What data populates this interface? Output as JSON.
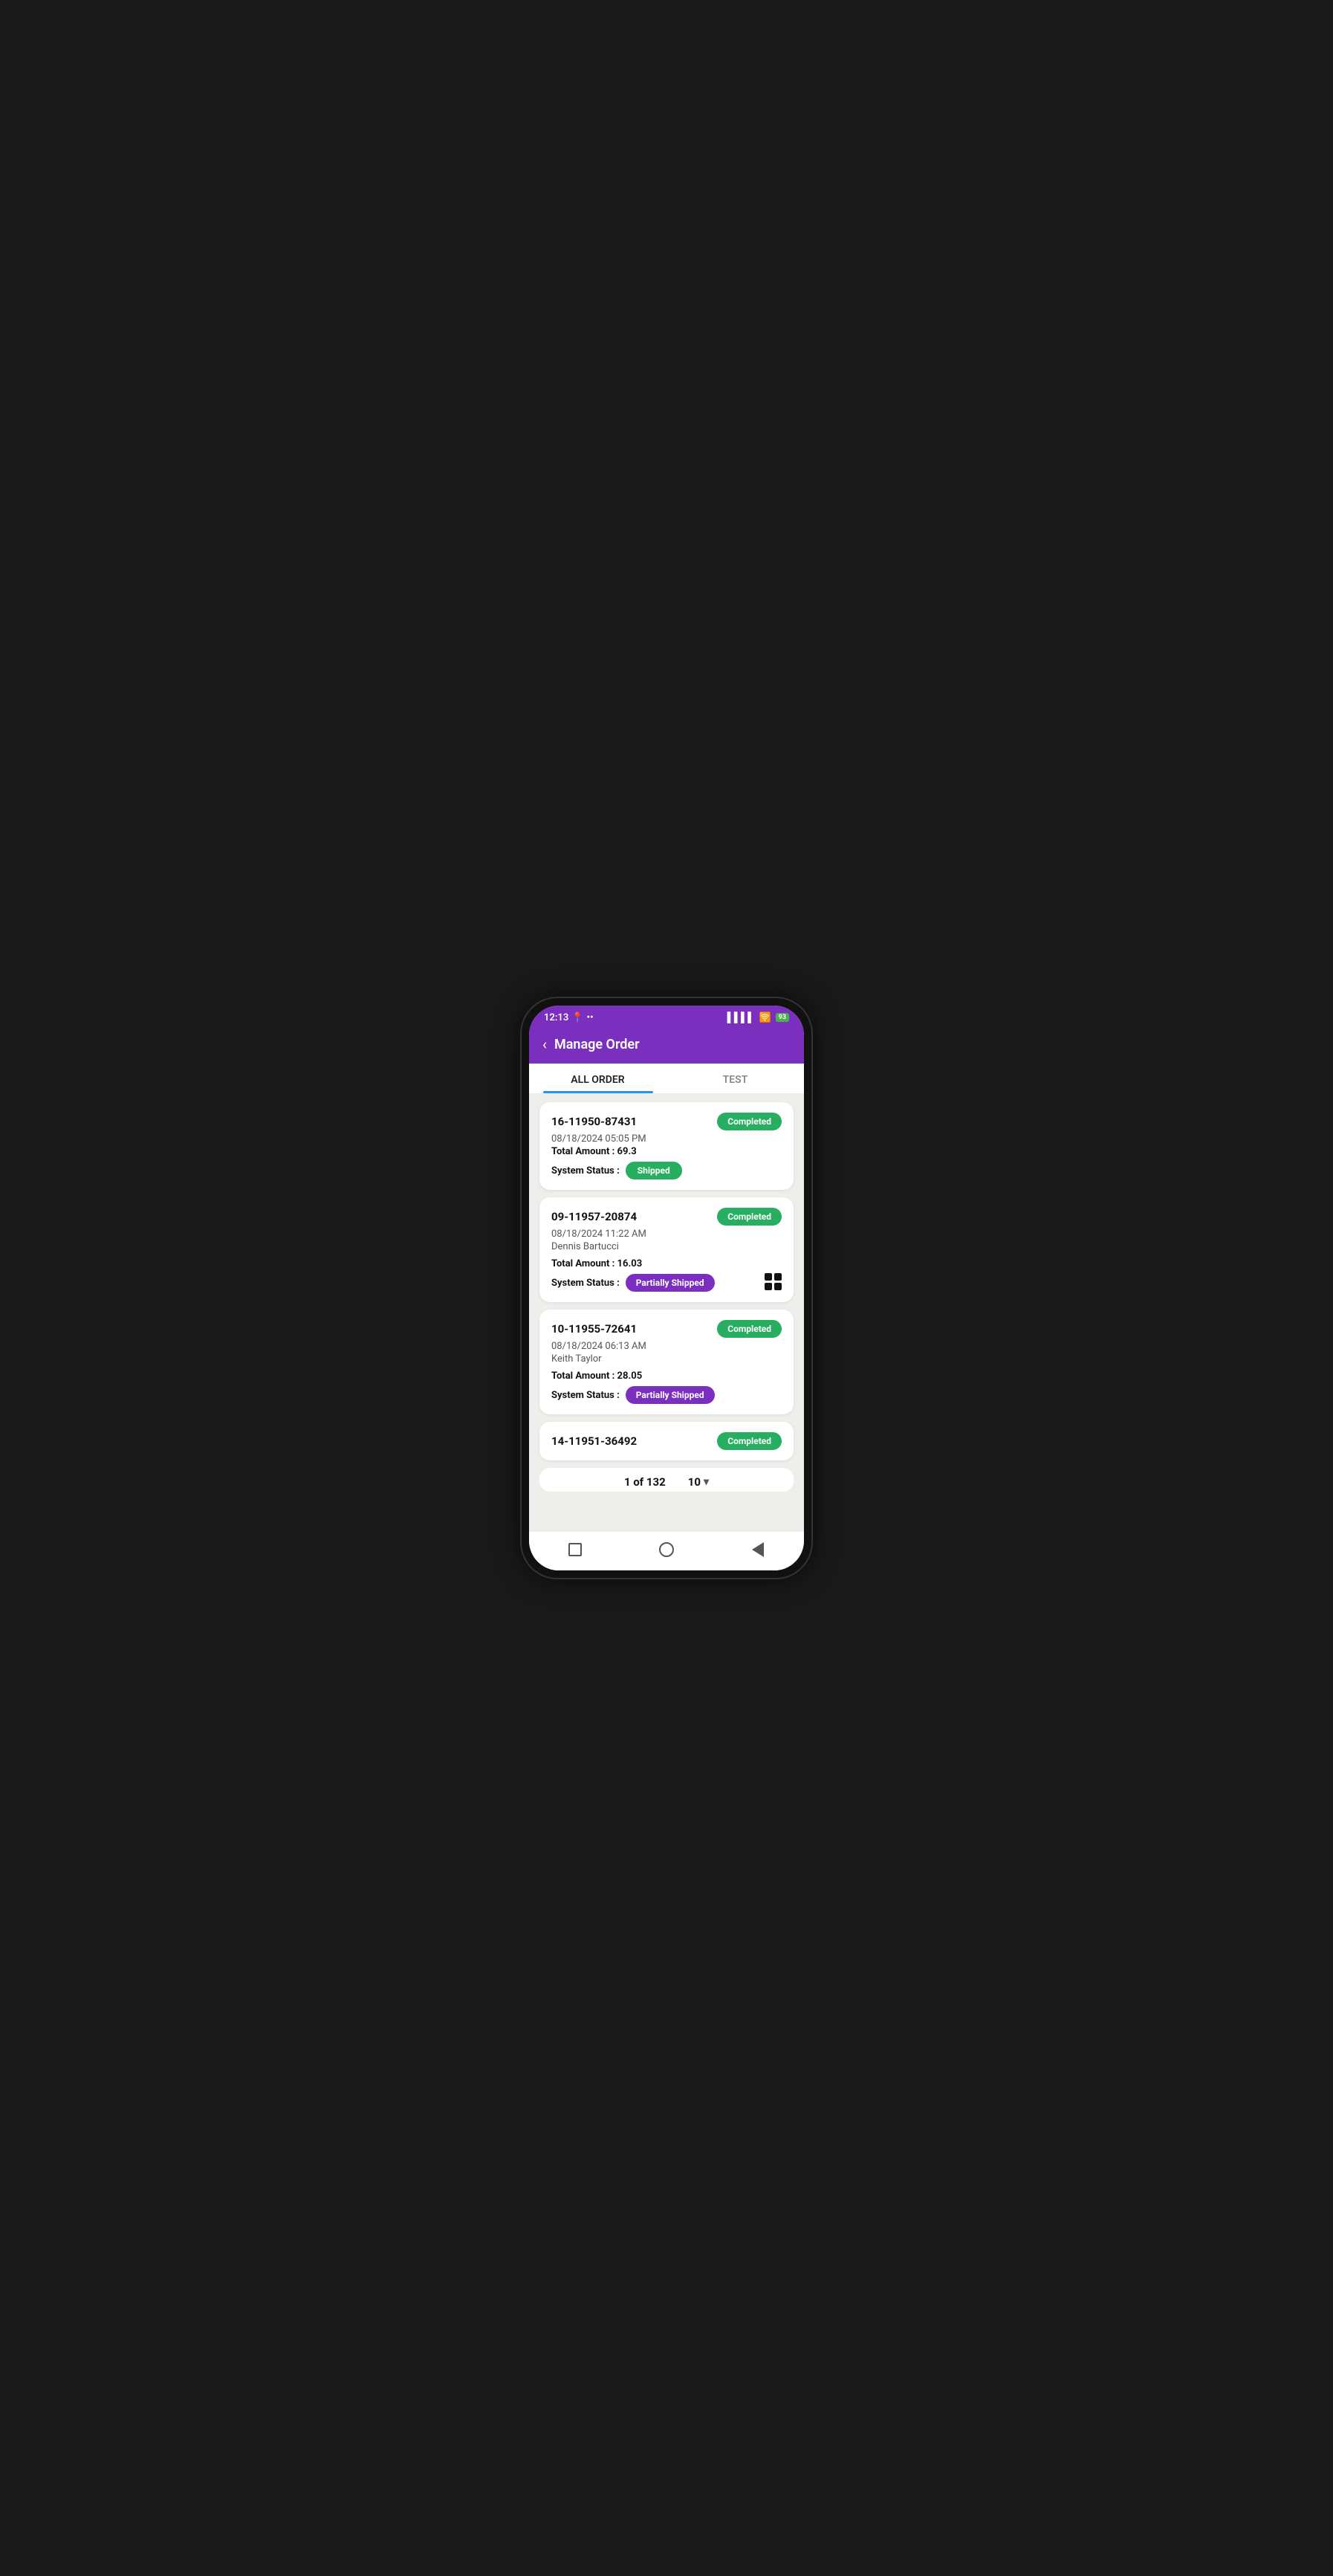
{
  "statusBar": {
    "time": "12:13",
    "battery": "93"
  },
  "header": {
    "title": "Manage Order",
    "backLabel": "‹"
  },
  "tabs": [
    {
      "id": "all-order",
      "label": "ALL ORDER",
      "active": true
    },
    {
      "id": "test",
      "label": "TEST",
      "active": false
    }
  ],
  "orders": [
    {
      "id": "16-11950-87431",
      "date": "08/18/2024 05:05 PM",
      "customer": "",
      "totalAmount": "69.3",
      "status": "Completed",
      "systemStatus": "Shipped",
      "systemStatusType": "shipped"
    },
    {
      "id": "09-11957-20874",
      "date": "08/18/2024 11:22 AM",
      "customer": "Dennis Bartucci",
      "totalAmount": "16.03",
      "status": "Completed",
      "systemStatus": "Partially Shipped",
      "systemStatusType": "partially-shipped"
    },
    {
      "id": "10-11955-72641",
      "date": "08/18/2024 06:13 AM",
      "customer": "Keith Taylor",
      "totalAmount": "28.05",
      "status": "Completed",
      "systemStatus": "Partially Shipped",
      "systemStatusType": "partially-shipped"
    },
    {
      "id": "14-11951-36492",
      "date": "",
      "customer": "",
      "totalAmount": "",
      "status": "Completed",
      "systemStatus": "",
      "systemStatusType": ""
    }
  ],
  "pagination": {
    "current": "1",
    "total": "132",
    "pageSize": "10",
    "label": "of"
  },
  "labels": {
    "totalAmount": "Total Amount :",
    "systemStatus": "System Status :"
  }
}
